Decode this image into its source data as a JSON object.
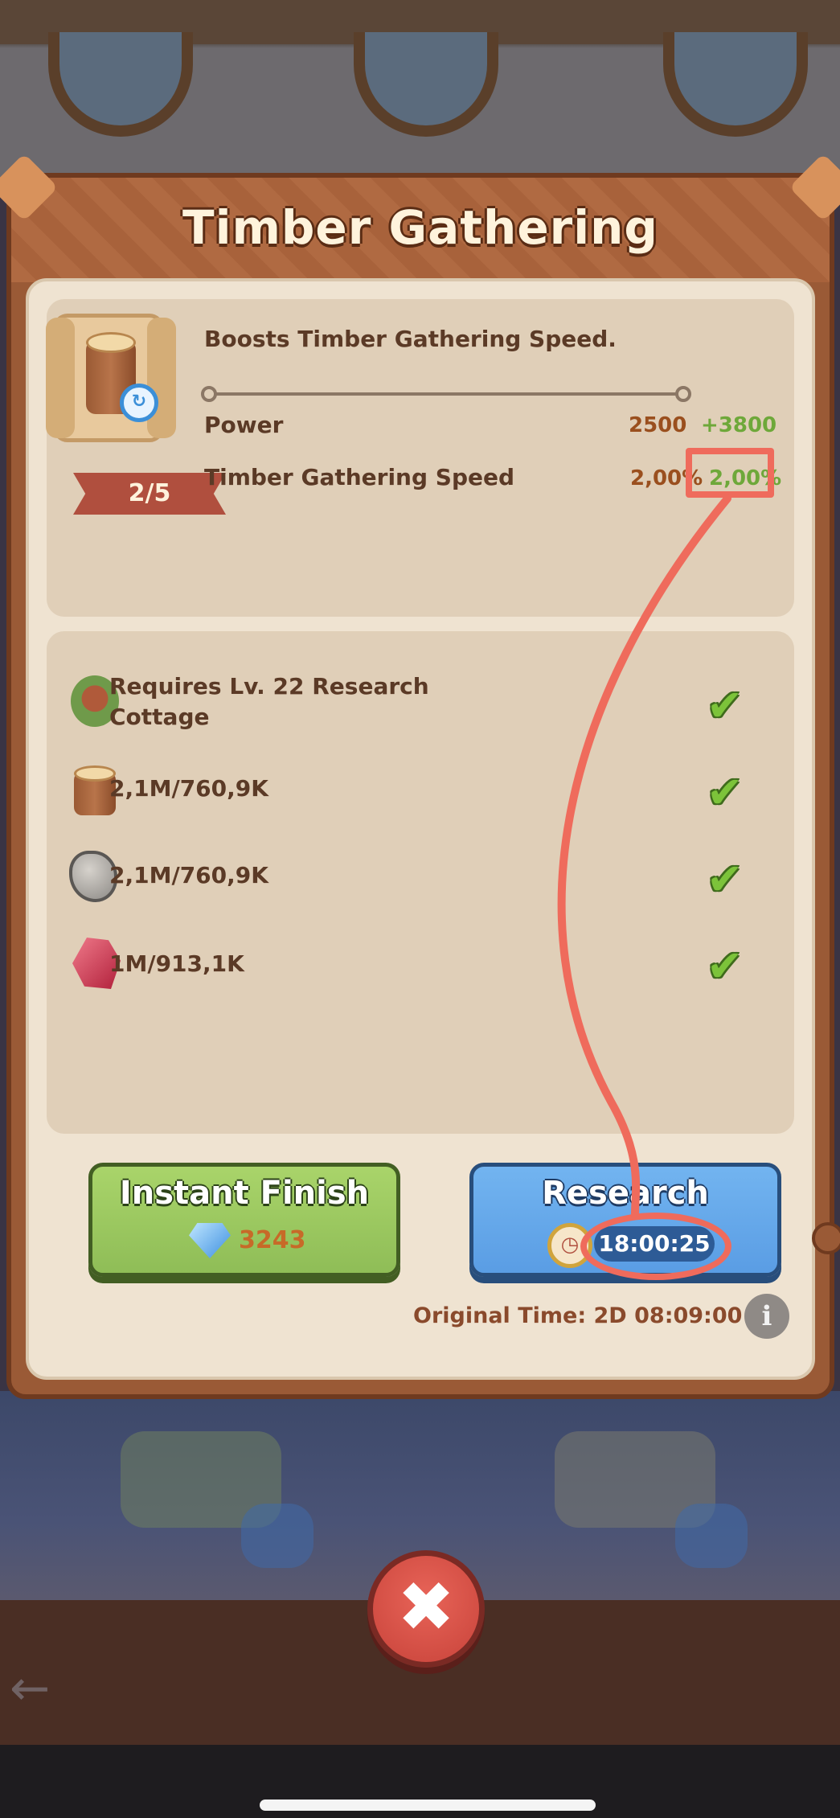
{
  "dialog": {
    "title": "Timber Gathering",
    "level": "2/5",
    "description": "Boosts Timber Gathering Speed."
  },
  "stats": [
    {
      "label": "Power",
      "current": "2500",
      "new": "+3800"
    },
    {
      "label": "Timber Gathering Speed",
      "current": "2,00%",
      "new": "2,00%"
    }
  ],
  "requirements": [
    {
      "text_line1": "Requires Lv. 22 Research",
      "text_line2": "Cottage",
      "icon": "cottage-icon",
      "met": true
    },
    {
      "text": "2,1M/760,9K",
      "icon": "wood-icon",
      "met": true
    },
    {
      "text": "2,1M/760,9K",
      "icon": "stone-icon",
      "met": true
    },
    {
      "text": "1M/913,1K",
      "icon": "ruby-icon",
      "met": true
    }
  ],
  "buttons": {
    "instant_finish_label": "Instant Finish",
    "instant_finish_cost": "3243",
    "research_label": "Research",
    "research_time": "18:00:25"
  },
  "original_time": "Original Time: 2D 08:09:00",
  "colors": {
    "annotation": "#ef6b5c",
    "bonus_green": "#6ea83a",
    "current_value": "#9a4f1e"
  }
}
